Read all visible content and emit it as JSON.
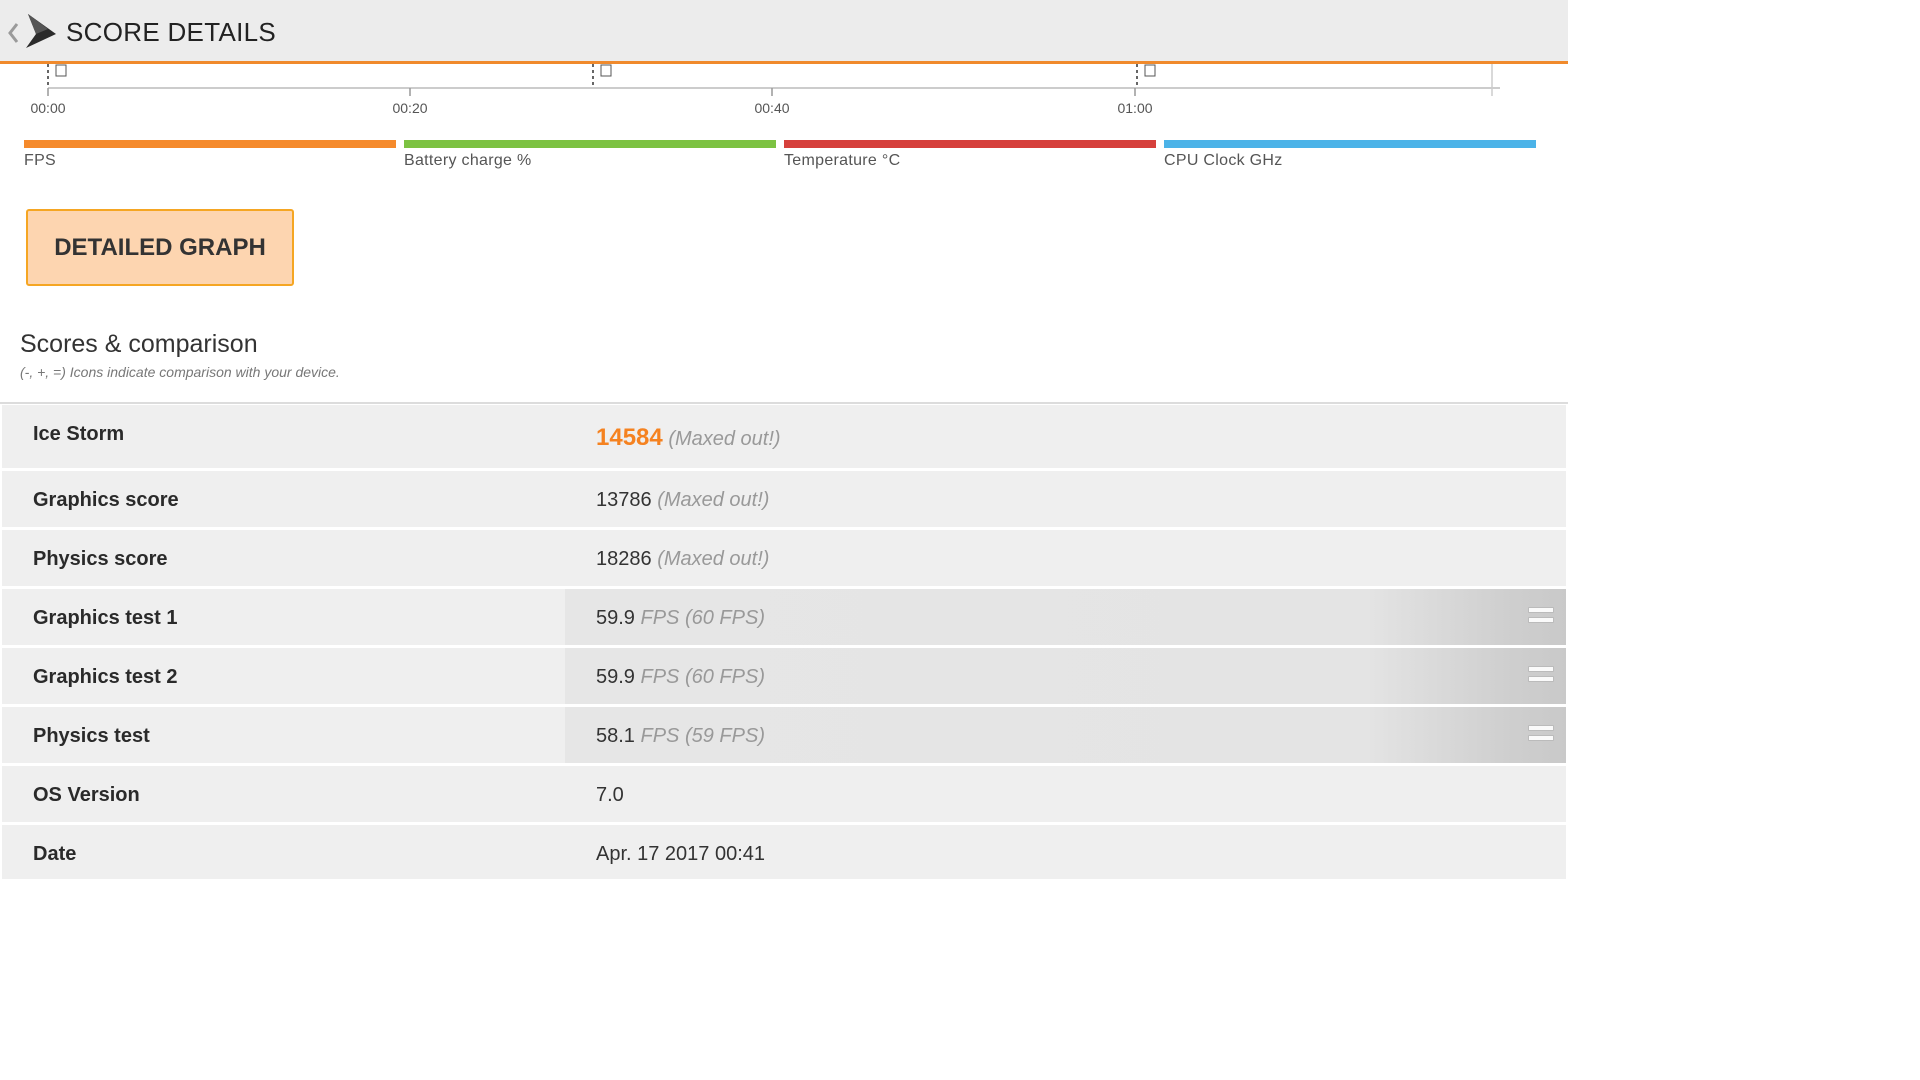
{
  "header": {
    "title": "SCORE DETAILS"
  },
  "timeline": {
    "ticks": [
      "00:00",
      "00:20",
      "00:40",
      "01:00"
    ]
  },
  "legend": [
    {
      "label": "FPS",
      "color": "#f58a2c"
    },
    {
      "label": "Battery charge %",
      "color": "#7cc242"
    },
    {
      "label": "Temperature °C",
      "color": "#d6403c"
    },
    {
      "label": "CPU Clock GHz",
      "color": "#4bb3e8"
    }
  ],
  "detailed_graph_label": "DETAILED GRAPH",
  "scores_section": {
    "title": "Scores & comparison",
    "subtitle": "(-, +, =) Icons indicate comparison with your device."
  },
  "rows": [
    {
      "label": "Ice Storm",
      "value": "14584",
      "note": "(Maxed out!)"
    },
    {
      "label": "Graphics score",
      "value": "13786",
      "note": "(Maxed out!)"
    },
    {
      "label": "Physics score",
      "value": "18286",
      "note": "(Maxed out!)"
    },
    {
      "label": "Graphics test 1",
      "value": "59.9",
      "note": "FPS (60 FPS)",
      "comparison": "equal-icon"
    },
    {
      "label": "Graphics test 2",
      "value": "59.9",
      "note": "FPS (60 FPS)",
      "comparison": "equal-icon"
    },
    {
      "label": "Physics test",
      "value": "58.1",
      "note": "FPS (59 FPS)",
      "comparison": "equal-icon"
    },
    {
      "label": "OS Version",
      "value": "7.0",
      "note": ""
    },
    {
      "label": "Date",
      "value": "Apr. 17 2017 00:41",
      "note": ""
    }
  ]
}
